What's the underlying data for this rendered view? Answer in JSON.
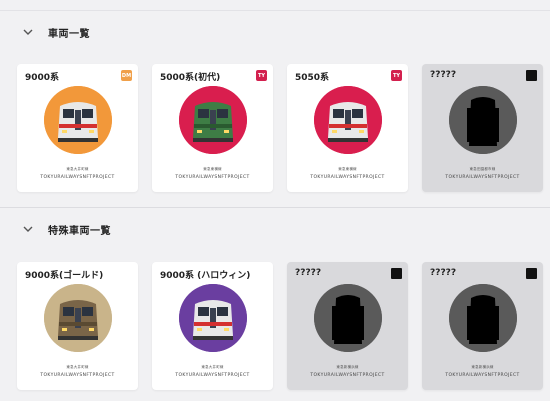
{
  "sections": [
    {
      "title": "車両一覧",
      "cards": [
        {
          "name": "9000系",
          "badge": "DM",
          "badge_color": "#f0a04a",
          "circle_color": "#f2983a",
          "train_color": "#e8e8e8",
          "stripe_color": "#d43030",
          "sub": "東急大井町線",
          "project": "TOKYURAILWAYSNFTPROJECT",
          "locked": false
        },
        {
          "name": "5000系(初代)",
          "badge": "TY",
          "badge_color": "#d3204e",
          "circle_color": "#d91e4e",
          "train_color": "#3e7d45",
          "stripe_color": "#2a5a30",
          "sub": "東急東横線",
          "project": "TOKYURAILWAYSNFTPROJECT",
          "locked": false
        },
        {
          "name": "5050系",
          "badge": "TY",
          "badge_color": "#d3204e",
          "circle_color": "#d91e4e",
          "train_color": "#e8e8e8",
          "stripe_color": "#d43030",
          "sub": "東急東横線",
          "project": "TOKYURAILWAYSNFTPROJECT",
          "locked": false
        },
        {
          "name": "?????",
          "badge": "",
          "badge_color": "#111111",
          "circle_color": "#5a5a5a",
          "train_color": "#000000",
          "stripe_color": "#000000",
          "sub": "東急田園都市線",
          "project": "TOKYURAILWAYSNFTPROJECT",
          "locked": true
        }
      ]
    },
    {
      "title": "特殊車両一覧",
      "cards": [
        {
          "name": "9000系(ゴールド)",
          "badge": "",
          "badge_color": "",
          "circle_color": "#c9b48a",
          "train_color": "#7a6548",
          "stripe_color": "#5a4a32",
          "sub": "東急大井町線",
          "project": "TOKYURAILWAYSNFTPROJECT",
          "locked": false
        },
        {
          "name": "9000系 (ハロウィン)",
          "badge": "",
          "badge_color": "",
          "circle_color": "#6a3ea0",
          "train_color": "#e8e8e8",
          "stripe_color": "#d43030",
          "sub": "東急大井町線",
          "project": "TOKYURAILWAYSNFTPROJECT",
          "locked": false
        },
        {
          "name": "?????",
          "badge": "",
          "badge_color": "#111111",
          "circle_color": "#5a5a5a",
          "train_color": "#000000",
          "stripe_color": "#000000",
          "sub": "東急新横浜線",
          "project": "TOKYURAILWAYSNFTPROJECT",
          "locked": true
        },
        {
          "name": "?????",
          "badge": "",
          "badge_color": "#111111",
          "circle_color": "#5a5a5a",
          "train_color": "#000000",
          "stripe_color": "#000000",
          "sub": "東急新横浜線",
          "project": "TOKYURAILWAYSNFTPROJECT",
          "locked": true
        }
      ]
    }
  ]
}
